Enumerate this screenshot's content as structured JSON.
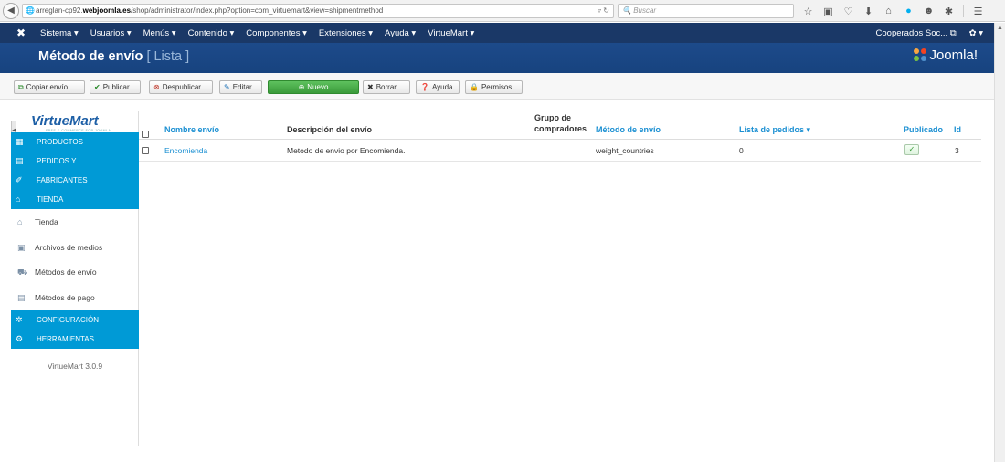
{
  "browser": {
    "url_prefix": "arreglan-cp92.",
    "url_domain": "webjoomla.es",
    "url_path": "/shop/administrator/index.php?option=com_virtuemart&view=shipmentmethod",
    "search_placeholder": "Buscar",
    "icons": [
      "star-icon",
      "clipboard-icon",
      "pocket-icon",
      "download-icon",
      "home-icon",
      "skype-icon",
      "chat-icon",
      "extension-icon",
      "menu-icon"
    ]
  },
  "navbar": {
    "menu": [
      "Sistema ▾",
      "Usuarios ▾",
      "Menús ▾",
      "Contenido ▾",
      "Componentes ▾",
      "Extensiones ▾",
      "Ayuda ▾",
      "VirtueMart ▾"
    ],
    "user_label": "Cooperados Soc... ⧉",
    "settings_label": "✿ ▾"
  },
  "titlebar": {
    "title": "Método de envío",
    "subtitle": "[ Lista ]",
    "logo_text": "Joomla!"
  },
  "toolbar": {
    "copy": "Copiar envío",
    "publish": "Publicar",
    "unpublish": "Despublicar",
    "edit": "Editar",
    "new": "Nuevo",
    "delete": "Borrar",
    "help": "Ayuda",
    "permissions": "Permisos"
  },
  "sidebar": {
    "logo_text": "VirtueMart",
    "logo_tagline": "FREE E-COMMERCE FOR JOOMLA",
    "headings": [
      "PRODUCTOS",
      "PEDIDOS Y",
      "FABRICANTES",
      "TIENDA",
      "CONFIGURACIÓN",
      "HERRAMIENTAS"
    ],
    "links": [
      "Tienda",
      "Archivos de medios",
      "Métodos de envío",
      "Métodos de pago"
    ],
    "version": "VirtueMart 3.0.9"
  },
  "table": {
    "headers": {
      "name": "Nombre envío",
      "description": "Descripción del envío",
      "group_line1": "Grupo de",
      "group_line2": "compradores",
      "method": "Método de envío",
      "order_list": "Lista de pedidos ▾",
      "published": "Publicado",
      "id": "Id"
    },
    "rows": [
      {
        "name": "Encomienda",
        "description": "Metodo de envio por Encomienda.",
        "group": "",
        "method": "weight_countries",
        "order_list": "0",
        "published": "✓",
        "id": "3"
      }
    ]
  }
}
